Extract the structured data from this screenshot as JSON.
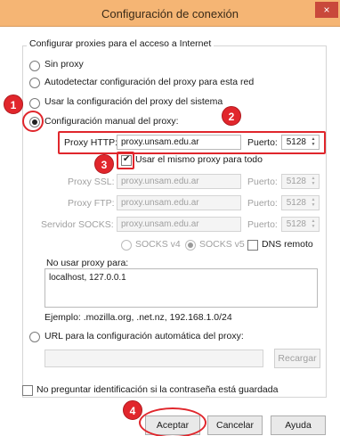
{
  "window": {
    "title": "Configuración de conexión",
    "close_glyph": "×"
  },
  "group": {
    "legend": "Configurar proxies para el acceso a Internet"
  },
  "options": {
    "no_proxy": "Sin proxy",
    "auto_detect": "Autodetectar configuración del proxy para esta red",
    "system": "Usar la configuración del proxy del sistema",
    "manual": "Configuración manual del proxy:",
    "auto_url": "URL para la configuración automática del proxy:"
  },
  "http": {
    "label": "Proxy HTTP:",
    "value": "proxy.unsam.edu.ar",
    "port_label": "Puerto:",
    "port": "5128"
  },
  "same_proxy_label": "Usar el mismo proxy para todo",
  "ssl": {
    "label": "Proxy SSL:",
    "value": "proxy.unsam.edu.ar",
    "port_label": "Puerto:",
    "port": "5128"
  },
  "ftp": {
    "label": "Proxy FTP:",
    "value": "proxy.unsam.edu.ar",
    "port_label": "Puerto:",
    "port": "5128"
  },
  "socks": {
    "label": "Servidor SOCKS:",
    "value": "proxy.unsam.edu.ar",
    "port_label": "Puerto:",
    "port": "5128",
    "v4_label": "SOCKS v4",
    "v5_label": "SOCKS v5",
    "dns_label": "DNS remoto"
  },
  "no_proxy_for": {
    "label": "No usar proxy para:",
    "value": "localhost, 127.0.0.1",
    "example": "Ejemplo: .mozilla.org, .net.nz, 192.168.1.0/24"
  },
  "reload_button": "Recargar",
  "no_auth_prompt_label": "No preguntar identificación si la contraseña está guardada",
  "buttons": {
    "ok": "Aceptar",
    "cancel": "Cancelar",
    "help": "Ayuda"
  },
  "annotations": {
    "badge_1": "1",
    "badge_2": "2",
    "badge_3": "3",
    "badge_4": "4"
  }
}
